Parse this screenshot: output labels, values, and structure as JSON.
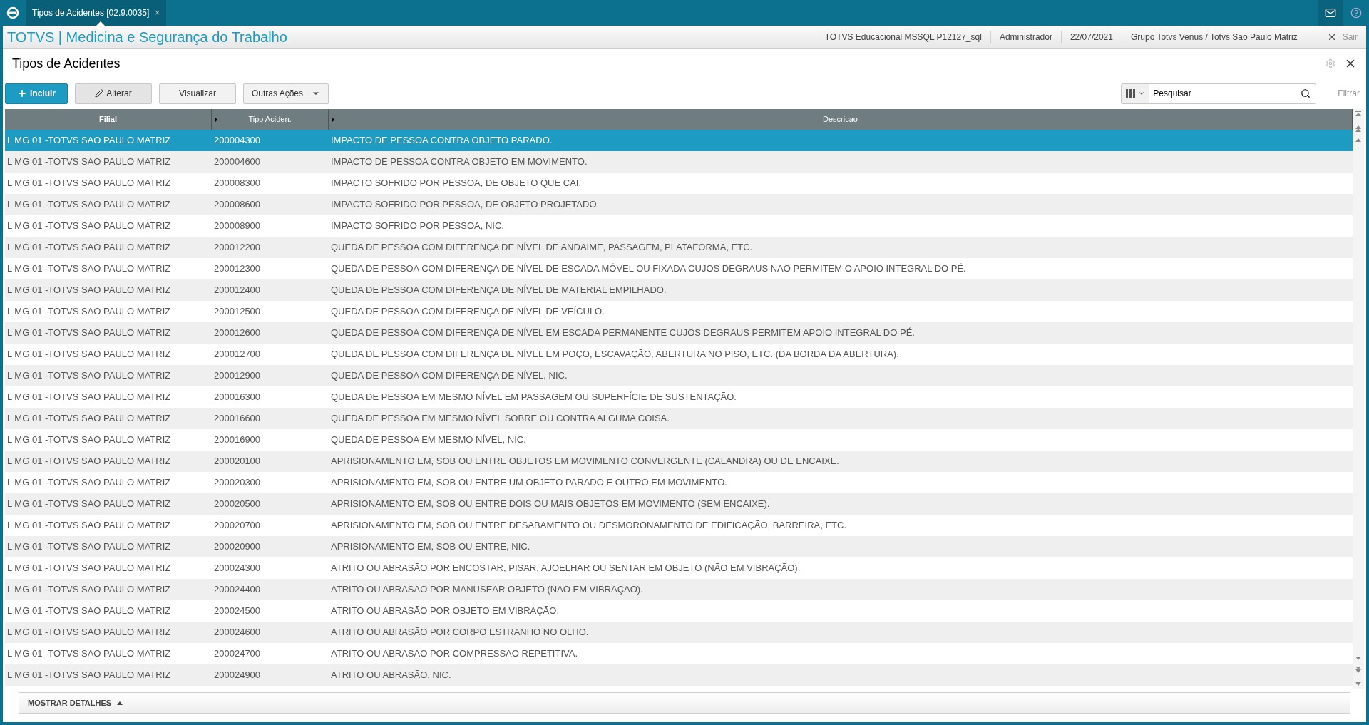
{
  "tab": {
    "label": "Tipos de Acidentes [02.9.0035]",
    "close": "×"
  },
  "header": {
    "app_title": "TOTVS | Medicina e Segurança do Trabalho",
    "info": [
      "TOTVS Educacional MSSQL P12127_sql",
      "Administrador",
      "22/07/2021",
      "Grupo Totvs Venus / Totvs Sao Paulo Matriz"
    ],
    "exit": "Sair"
  },
  "page": {
    "title": "Tipos de Acidentes"
  },
  "toolbar": {
    "buttons": [
      {
        "label": "Incluir",
        "kind": "primary"
      },
      {
        "label": "Alterar",
        "kind": "edit"
      },
      {
        "label": "Visualizar",
        "kind": "plain"
      },
      {
        "label": "Outras Ações",
        "kind": "menu"
      }
    ],
    "search": {
      "value": "Pesquisar"
    },
    "filter": "Filtrar"
  },
  "table": {
    "columns": [
      "Filial",
      "Tipo Aciden.",
      "Descricao"
    ],
    "rows": [
      {
        "cells": [
          "L MG 01 -TOTVS SAO PAULO MATRIZ",
          "200004300",
          "IMPACTO DE PESSOA CONTRA OBJETO PARADO."
        ],
        "selected": true
      },
      {
        "cells": [
          "L MG 01 -TOTVS SAO PAULO MATRIZ",
          "200004600",
          "IMPACTO DE PESSOA CONTRA OBJETO EM MOVIMENTO."
        ],
        "selected": false
      },
      {
        "cells": [
          "L MG 01 -TOTVS SAO PAULO MATRIZ",
          "200008300",
          "IMPACTO SOFRIDO POR PESSOA, DE OBJETO QUE CAI."
        ],
        "selected": false
      },
      {
        "cells": [
          "L MG 01 -TOTVS SAO PAULO MATRIZ",
          "200008600",
          "IMPACTO SOFRIDO POR PESSOA, DE OBJETO PROJETADO."
        ],
        "selected": false
      },
      {
        "cells": [
          "L MG 01 -TOTVS SAO PAULO MATRIZ",
          "200008900",
          "IMPACTO SOFRIDO POR PESSOA, NIC."
        ],
        "selected": false
      },
      {
        "cells": [
          "L MG 01 -TOTVS SAO PAULO MATRIZ",
          "200012200",
          "QUEDA DE PESSOA COM DIFERENÇA DE NÍVEL DE ANDAIME, PASSAGEM, PLATAFORMA, ETC."
        ],
        "selected": false
      },
      {
        "cells": [
          "L MG 01 -TOTVS SAO PAULO MATRIZ",
          "200012300",
          "QUEDA DE PESSOA COM DIFERENÇA DE NÍVEL DE ESCADA MÓVEL OU FIXADA CUJOS DEGRAUS NÃO PERMITEM O APOIO INTEGRAL DO PÉ."
        ],
        "selected": false
      },
      {
        "cells": [
          "L MG 01 -TOTVS SAO PAULO MATRIZ",
          "200012400",
          "QUEDA DE PESSOA COM DIFERENÇA DE NÍVEL DE MATERIAL EMPILHADO."
        ],
        "selected": false
      },
      {
        "cells": [
          "L MG 01 -TOTVS SAO PAULO MATRIZ",
          "200012500",
          "QUEDA DE PESSOA COM DIFERENÇA DE NÍVEL DE VEÍCULO."
        ],
        "selected": false
      },
      {
        "cells": [
          "L MG 01 -TOTVS SAO PAULO MATRIZ",
          "200012600",
          "QUEDA DE PESSOA COM DIFERENÇA DE NÍVEL EM ESCADA PERMANENTE CUJOS DEGRAUS PERMITEM APOIO INTEGRAL DO PÉ."
        ],
        "selected": false
      },
      {
        "cells": [
          "L MG 01 -TOTVS SAO PAULO MATRIZ",
          "200012700",
          "QUEDA DE PESSOA COM DIFERENÇA DE NÍVEL EM POÇO, ESCAVAÇÃO, ABERTURA NO PISO, ETC. (DA BORDA DA ABERTURA)."
        ],
        "selected": false
      },
      {
        "cells": [
          "L MG 01 -TOTVS SAO PAULO MATRIZ",
          "200012900",
          "QUEDA DE PESSOA COM DIFERENÇA DE NÍVEL, NIC."
        ],
        "selected": false
      },
      {
        "cells": [
          "L MG 01 -TOTVS SAO PAULO MATRIZ",
          "200016300",
          "QUEDA DE PESSOA EM MESMO NÍVEL EM PASSAGEM OU SUPERFÍCIE DE SUSTENTAÇÃO."
        ],
        "selected": false
      },
      {
        "cells": [
          "L MG 01 -TOTVS SAO PAULO MATRIZ",
          "200016600",
          "QUEDA DE PESSOA EM MESMO NÍVEL SOBRE OU CONTRA ALGUMA COISA."
        ],
        "selected": false
      },
      {
        "cells": [
          "L MG 01 -TOTVS SAO PAULO MATRIZ",
          "200016900",
          "QUEDA DE PESSOA EM MESMO NÍVEL, NIC."
        ],
        "selected": false
      },
      {
        "cells": [
          "L MG 01 -TOTVS SAO PAULO MATRIZ",
          "200020100",
          "APRISIONAMENTO EM, SOB OU ENTRE OBJETOS EM MOVIMENTO CONVERGENTE (CALANDRA) OU DE ENCAIXE."
        ],
        "selected": false
      },
      {
        "cells": [
          "L MG 01 -TOTVS SAO PAULO MATRIZ",
          "200020300",
          "APRISIONAMENTO EM, SOB OU ENTRE UM OBJETO PARADO E OUTRO EM MOVIMENTO."
        ],
        "selected": false
      },
      {
        "cells": [
          "L MG 01 -TOTVS SAO PAULO MATRIZ",
          "200020500",
          "APRISIONAMENTO EM, SOB OU ENTRE DOIS OU MAIS OBJETOS EM MOVIMENTO (SEM ENCAIXE)."
        ],
        "selected": false
      },
      {
        "cells": [
          "L MG 01 -TOTVS SAO PAULO MATRIZ",
          "200020700",
          "APRISIONAMENTO EM, SOB OU ENTRE DESABAMENTO OU DESMORONAMENTO DE EDIFICAÇÃO, BARREIRA, ETC."
        ],
        "selected": false
      },
      {
        "cells": [
          "L MG 01 -TOTVS SAO PAULO MATRIZ",
          "200020900",
          "APRISIONAMENTO EM, SOB OU ENTRE, NIC."
        ],
        "selected": false
      },
      {
        "cells": [
          "L MG 01 -TOTVS SAO PAULO MATRIZ",
          "200024300",
          "ATRITO OU ABRASÃO POR ENCOSTAR, PISAR, AJOELHAR OU SENTAR EM OBJETO (NÃO EM VIBRAÇÃO)."
        ],
        "selected": false
      },
      {
        "cells": [
          "L MG 01 -TOTVS SAO PAULO MATRIZ",
          "200024400",
          "ATRITO OU ABRASÃO POR MANUSEAR OBJETO (NÃO EM VIBRAÇÃO)."
        ],
        "selected": false
      },
      {
        "cells": [
          "L MG 01 -TOTVS SAO PAULO MATRIZ",
          "200024500",
          "ATRITO OU ABRASÃO POR OBJETO EM VIBRAÇÃO."
        ],
        "selected": false
      },
      {
        "cells": [
          "L MG 01 -TOTVS SAO PAULO MATRIZ",
          "200024600",
          "ATRITO OU ABRASÃO POR CORPO ESTRANHO NO OLHO."
        ],
        "selected": false
      },
      {
        "cells": [
          "L MG 01 -TOTVS SAO PAULO MATRIZ",
          "200024700",
          "ATRITO OU ABRASÃO POR COMPRESSÃO REPETITIVA."
        ],
        "selected": false
      },
      {
        "cells": [
          "L MG 01 -TOTVS SAO PAULO MATRIZ",
          "200024900",
          "ATRITO OU ABRASÃO, NIC."
        ],
        "selected": false
      }
    ]
  },
  "footer": {
    "details": "MOSTRAR DETALHES"
  }
}
